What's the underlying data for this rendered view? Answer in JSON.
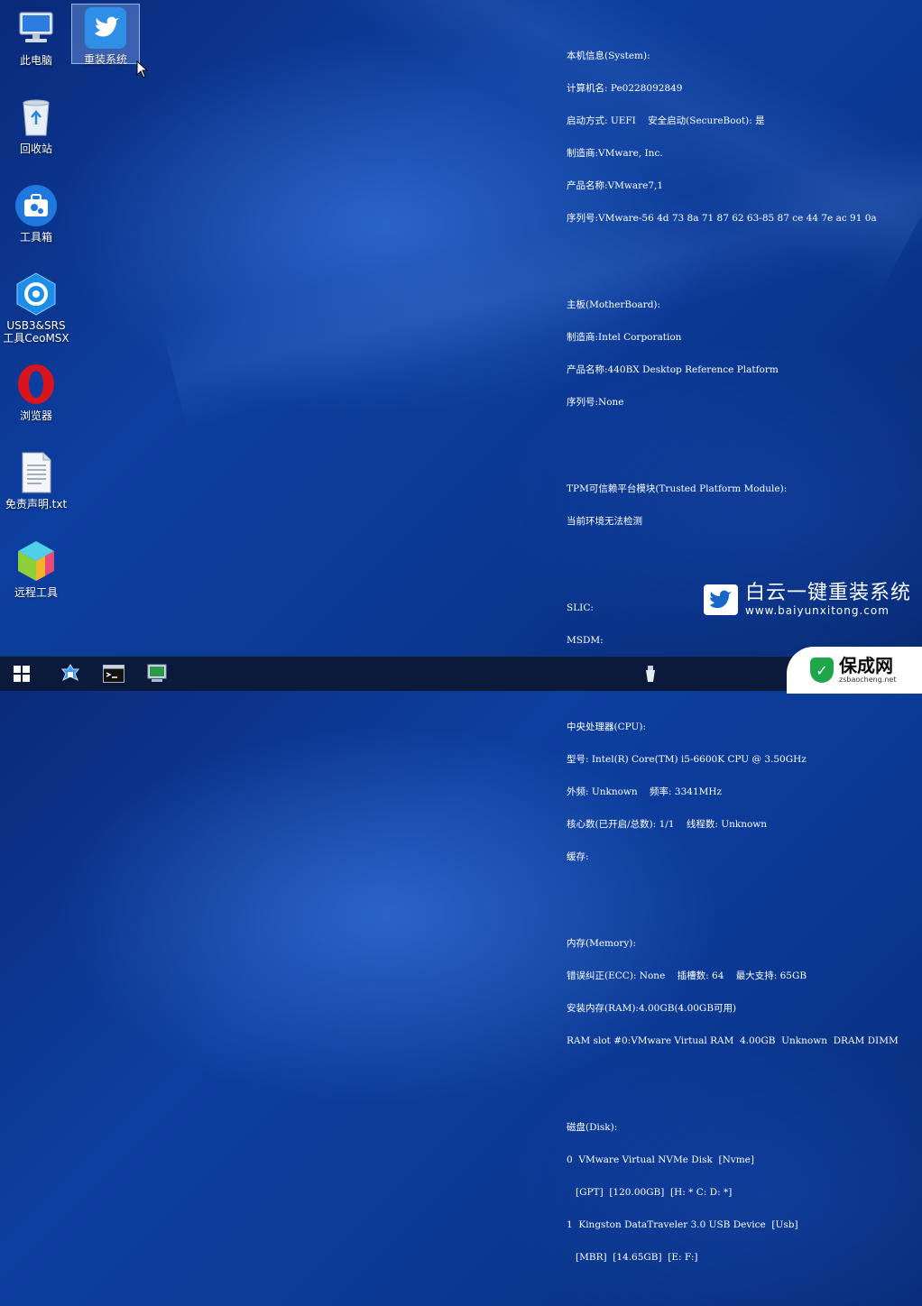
{
  "desktop": {
    "icons": [
      {
        "label": "此电脑"
      },
      {
        "label": "重装系统"
      },
      {
        "label": "回收站"
      },
      {
        "label": "工具箱"
      },
      {
        "label": "USB3&SRS\n工具CeoMSX"
      },
      {
        "label": "浏览器"
      },
      {
        "label": "免责声明.txt"
      },
      {
        "label": "远程工具"
      }
    ]
  },
  "sysinfo": {
    "system": [
      "本机信息(System):",
      "计算机名: Pe0228092849",
      "启动方式: UEFI    安全启动(SecureBoot): 是",
      "制造商:VMware, Inc.",
      "产品名称:VMware7,1",
      "序列号:VMware-56 4d 73 8a 71 87 62 63-85 87 ce 44 7e ac 91 0a"
    ],
    "motherboard": [
      "主板(MotherBoard):",
      "制造商:Intel Corporation",
      "产品名称:440BX Desktop Reference Platform",
      "序列号:None"
    ],
    "tpm": [
      "TPM可信赖平台模块(Trusted Platform Module):",
      "当前环境无法检测"
    ],
    "slic": [
      "SLIC:",
      "MSDM:"
    ],
    "cpu": [
      "中央处理器(CPU):",
      "型号: Intel(R) Core(TM) i5-6600K CPU @ 3.50GHz",
      "外频: Unknown    频率: 3341MHz",
      "核心数(已开启/总数): 1/1    线程数: Unknown",
      "缓存:"
    ],
    "memory": [
      "内存(Memory):",
      "错误纠正(ECC): None    插槽数: 64    最大支持: 65GB",
      "安装内存(RAM):4.00GB(4.00GB可用)",
      "RAM slot #0:VMware Virtual RAM  4.00GB  Unknown  DRAM DIMM"
    ],
    "disk": [
      "磁盘(Disk):",
      "0  VMware Virtual NVMe Disk  [Nvme]",
      "   [GPT]  [120.00GB]  [H: * C: D: *]",
      "1  Kingston DataTraveler 3.0 USB Device  [Usb]",
      "   [MBR]  [14.65GB]  [E: F:]"
    ]
  },
  "brand": {
    "name": "白云一键重装系统",
    "url": "www.baiyunxitong.com"
  },
  "watermark": {
    "name": "保成网",
    "url": "zsbaocheng.net"
  },
  "colors": {
    "desktop_bg": "#0d3fa0",
    "taskbar_bg": "#0b1a3a",
    "watermark_green": "#1fa64a"
  }
}
